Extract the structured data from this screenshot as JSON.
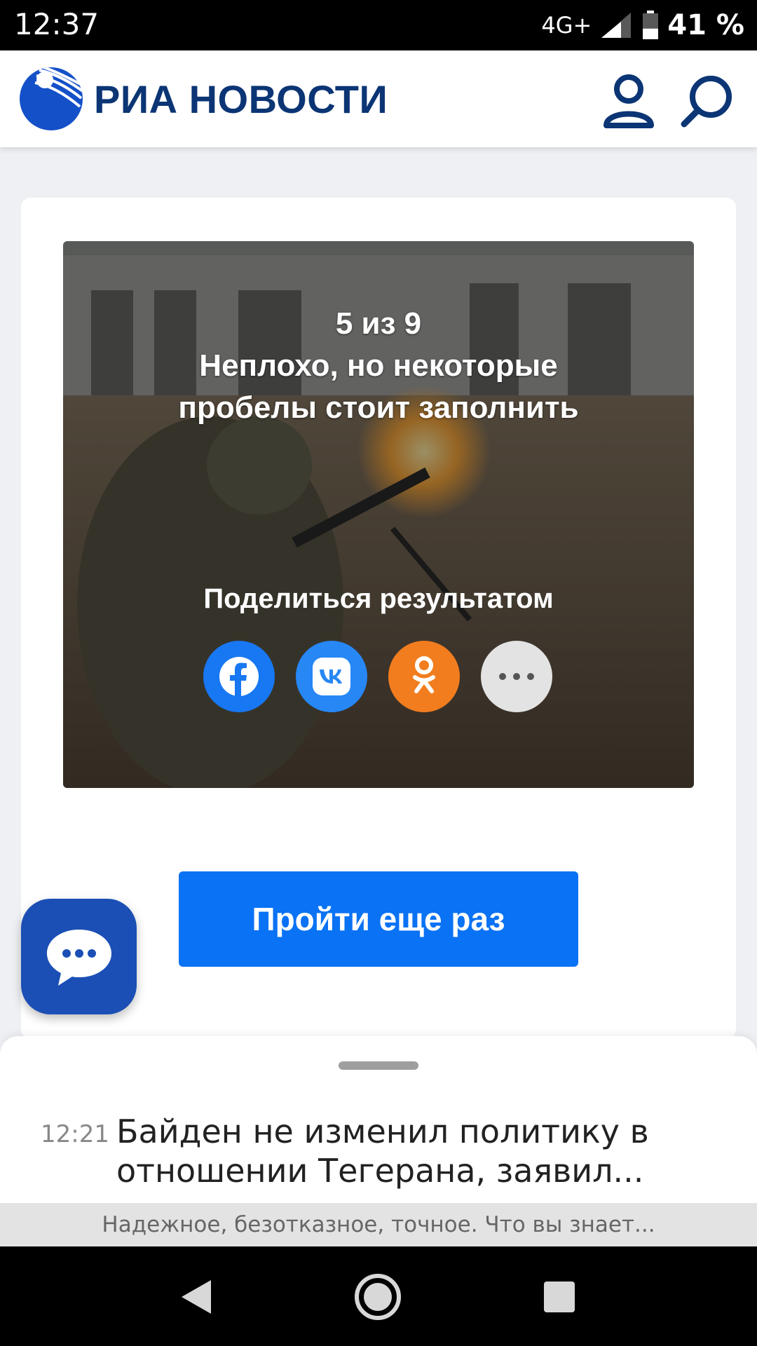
{
  "status_bar": {
    "time": "12:37",
    "network": "4G+",
    "battery_percent": "41 %",
    "battery_level": 0.41
  },
  "header": {
    "logo_text": "РИА НОВОСТИ",
    "logo_color": "#0b3574",
    "icons": [
      "profile-icon",
      "search-icon"
    ]
  },
  "quiz_result": {
    "score": "5 из 9",
    "verdict": "Неплохо, но некоторые пробелы стоит заполнить",
    "share_label": "Поделиться результатом",
    "share_buttons": [
      {
        "icon": "facebook-icon",
        "color": "#1877f2"
      },
      {
        "icon": "vk-icon",
        "color": "#2787f5"
      },
      {
        "icon": "odnoklassniki-icon",
        "color": "#f27d1e"
      },
      {
        "icon": "more-icon",
        "color": "#e3e3e3"
      }
    ],
    "retry_label": "Пройти еще раз",
    "retry_color": "#0a72f4"
  },
  "chat_fab": {
    "icon": "chat-bubble-icon",
    "color": "#1b4fb5"
  },
  "news_feed": {
    "time": "12:21",
    "title": "Байден не изменил политику в отношении Тегерана, заявил..."
  },
  "teaser": {
    "text": "Надежное, безотказное, точное. Что вы знает..."
  },
  "nav_bar": {
    "icons": [
      "back-icon",
      "home-icon",
      "recents-icon"
    ]
  }
}
